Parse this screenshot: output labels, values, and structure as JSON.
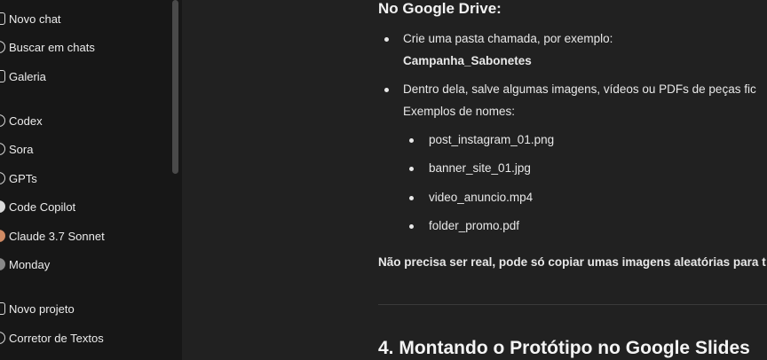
{
  "sidebar": {
    "items": [
      {
        "label": "Novo chat",
        "icon": "new-chat-icon"
      },
      {
        "label": "Buscar em chats",
        "icon": "search-icon"
      },
      {
        "label": "Galeria",
        "icon": "gallery-icon"
      },
      {
        "label": "Codex",
        "icon": "codex-icon"
      },
      {
        "label": "Sora",
        "icon": "sora-icon"
      },
      {
        "label": "GPTs",
        "icon": "gpts-icon"
      },
      {
        "label": "Code Copilot",
        "icon": "code-copilot-icon"
      },
      {
        "label": "Claude 3.7 Sonnet",
        "icon": "claude-avatar-icon"
      },
      {
        "label": "Monday",
        "icon": "monday-avatar-icon"
      },
      {
        "label": "Novo projeto",
        "icon": "new-project-icon"
      },
      {
        "label": "Corretor de Textos",
        "icon": "project-folder-icon"
      }
    ]
  },
  "message": {
    "heading": "No Google Drive:",
    "bullet1_text": "Crie uma pasta chamada, por exemplo:",
    "bullet1_bold": "Campanha_Sabonetes",
    "bullet2_text": "Dentro dela, salve algumas imagens, vídeos ou PDFs de peças fic",
    "bullet2_line2": "Exemplos de nomes:",
    "files": [
      "post_instagram_01.png",
      "banner_site_01.jpg",
      "video_anuncio.mp4",
      "folder_promo.pdf"
    ],
    "note": "Não precisa ser real, pode só copiar umas imagens aleatórias para t",
    "section_title": "4. Montando o Protótipo no Google Slides"
  }
}
